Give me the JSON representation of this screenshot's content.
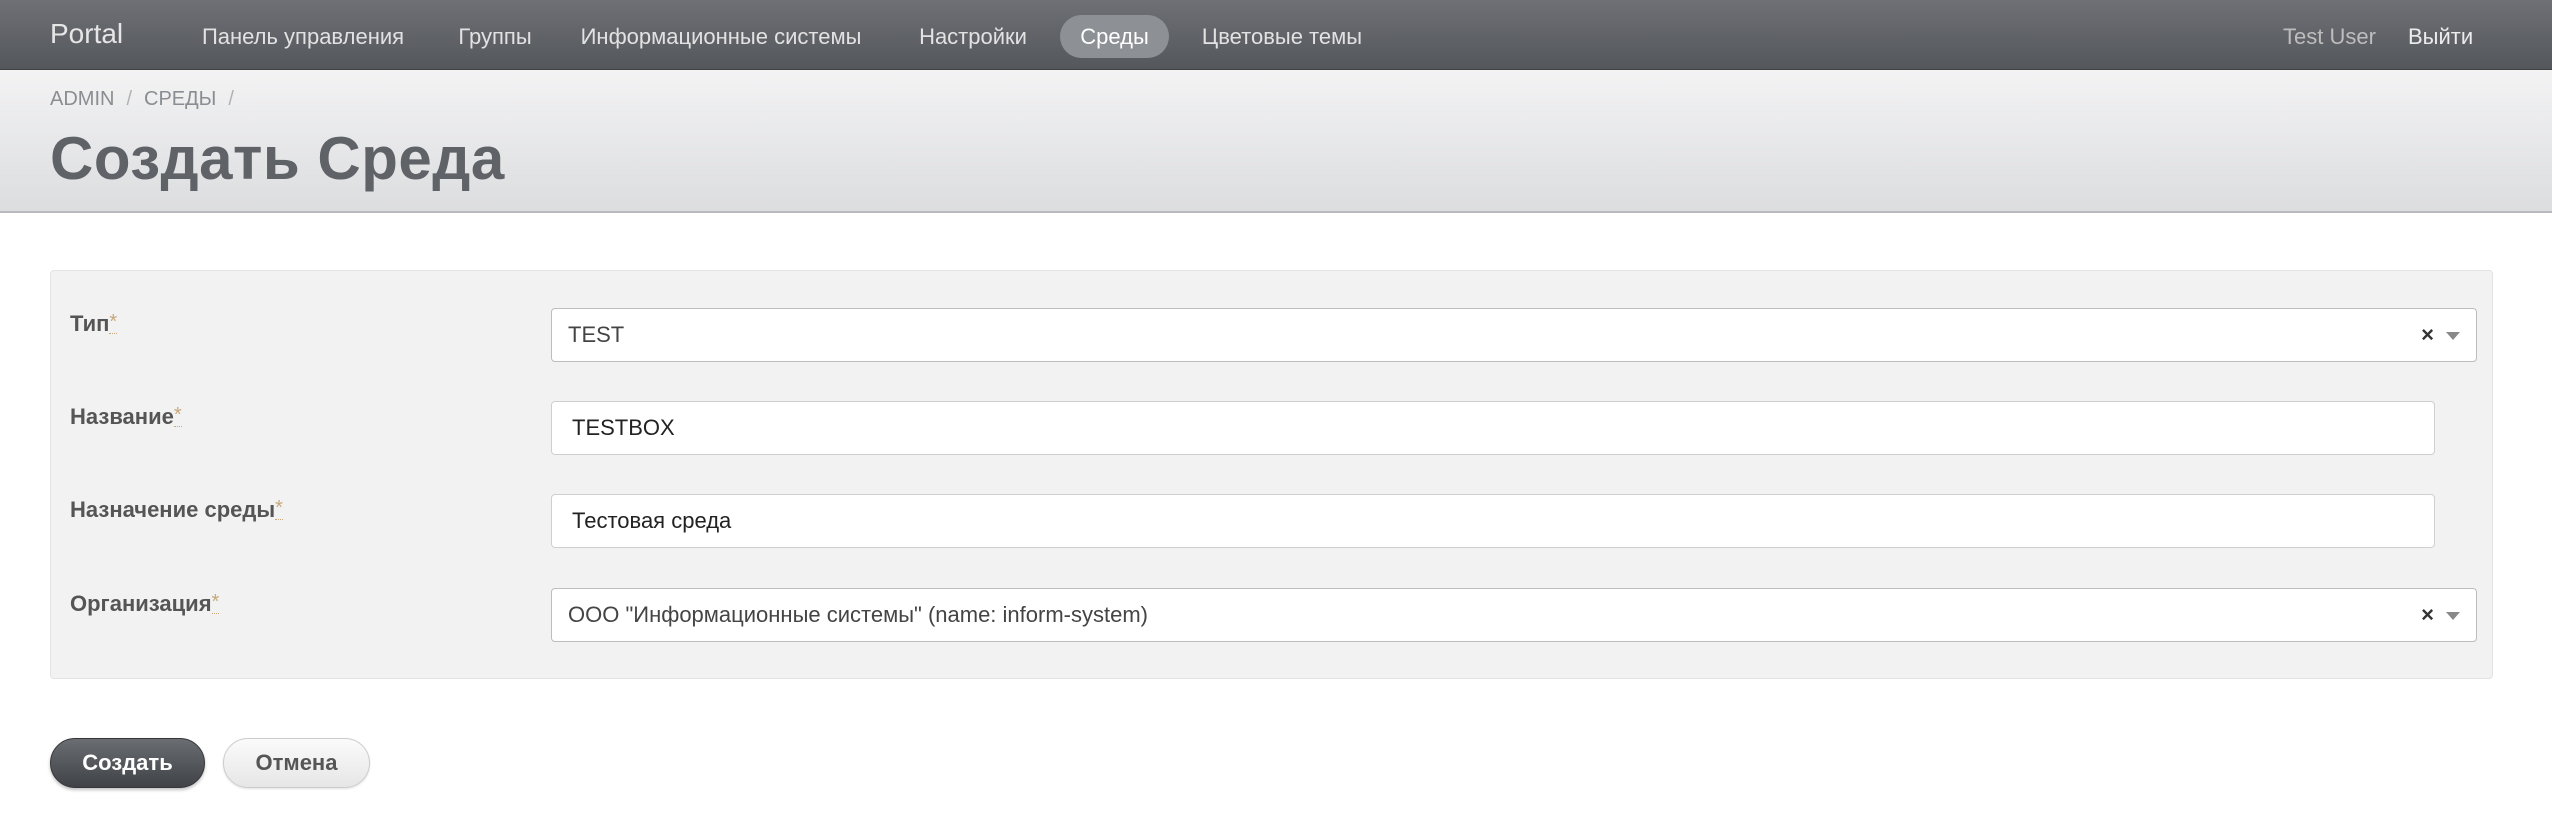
{
  "navbar": {
    "brand": "Portal",
    "items": [
      {
        "label": "Панель управления",
        "active": false
      },
      {
        "label": "Группы",
        "active": false
      },
      {
        "label": "Информационные системы",
        "active": false
      },
      {
        "label": "Настройки",
        "active": false
      },
      {
        "label": "Среды",
        "active": true
      },
      {
        "label": "Цветовые темы",
        "active": false
      }
    ],
    "user": "Test User",
    "logout": "Выйти"
  },
  "breadcrumb": {
    "items": [
      "ADMIN",
      "СРЕДЫ"
    ],
    "separator": "/"
  },
  "page": {
    "title": "Создать Среда"
  },
  "form": {
    "required_mark": "*",
    "fields": [
      {
        "label": "Тип",
        "type": "select",
        "value": "TEST",
        "clear": "×"
      },
      {
        "label": "Название",
        "type": "text",
        "value": "TESTBOX"
      },
      {
        "label": "Назначение среды",
        "type": "text",
        "value": "Тестовая среда"
      },
      {
        "label": "Организация",
        "type": "select",
        "value": "ООО \"Информационные системы\" (name: inform-system)",
        "clear": "×"
      }
    ]
  },
  "actions": {
    "submit": "Создать",
    "cancel": "Отмена"
  },
  "colors": {
    "navbar": "#5f6267",
    "nav_active": "#8d9095",
    "primary_button": "#4f5256",
    "required_mark": "#c7a87a"
  }
}
